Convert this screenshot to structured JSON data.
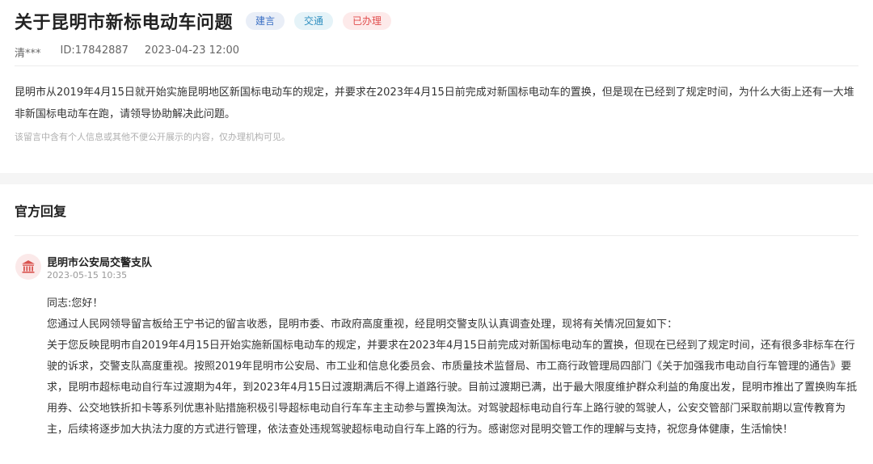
{
  "question": {
    "title": "关于昆明市新标电动车问题",
    "tags": [
      "建言",
      "交通",
      "已办理"
    ],
    "author": "清***",
    "id": "ID:17842887",
    "datetime": "2023-04-23 12:00",
    "content": "昆明市从2019年4月15日就开始实施昆明地区新国标电动车的规定，并要求在2023年4月15日前完成对新国标电动车的置换，但是现在已经到了规定时间，为什么大街上还有一大堆非新国标电动车在跑，请领导协助解决此问题。",
    "notice": "该留言中含有个人信息或其他不便公开展示的内容，仅办理机构可见。"
  },
  "reply": {
    "section_title": "官方回复",
    "org_name": "昆明市公安局交警支队",
    "datetime": "2023-05-15 10:35",
    "avatar_icon": "government-building-icon",
    "paragraphs": [
      "同志:您好！",
      "您通过人民网领导留言板给王宁书记的留言收悉，昆明市委、市政府高度重视，经昆明交警支队认真调查处理，现将有关情况回复如下：",
      "关于您反映昆明市自2019年4月15日开始实施新国标电动车的规定，并要求在2023年4月15日前完成对新国标电动车的置换，但现在已经到了规定时间，还有很多非标车在行驶的诉求，交警支队高度重视。按照2019年昆明市公安局、市工业和信息化委员会、市质量技术监督局、市工商行政管理局四部门《关于加强我市电动自行车管理的通告》要求，昆明市超标电动自行车过渡期为4年，到2023年4月15日过渡期满后不得上道路行驶。目前过渡期已满，出于最大限度维护群众利益的角度出发，昆明市推出了置换购车抵用券、公交地铁折扣卡等系列优惠补贴措施积极引导超标电动自行车车主主动参与置换淘汰。对驾驶超标电动自行车上路行驶的驾驶人，公安交管部门采取前期以宣传教育为主，后续将逐步加大执法力度的方式进行管理，依法查处违规驾驶超标电动自行车上路的行为。感谢您对昆明交管工作的理解与支持，祝您身体健康，生活愉快！"
    ]
  },
  "colors": {
    "tag_suggestion": "#3a6fc4",
    "tag_traffic": "#2f8fc0",
    "tag_done": "#e14d4d",
    "avatar_bg": "#fbe9e9",
    "avatar_icon": "#d9534f"
  }
}
